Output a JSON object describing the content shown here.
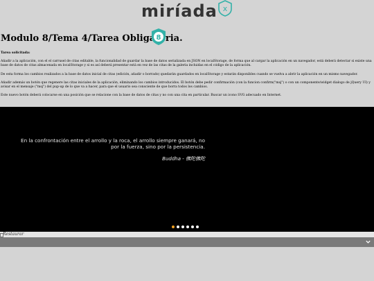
{
  "header": {
    "logo_text": "miríada",
    "logo_badge": "x"
  },
  "page": {
    "title": "Modulo 8/Tema 4/Tarea Obligatoria.",
    "title_badge": "8"
  },
  "task": {
    "label": "Tarea solicitada:",
    "paragraphs": [
      "Añadir a la aplicación, con el el carrusel de citas editable, la funcionalidad de guardar la base de datos serializada en JSON en localStorage, de forma que al cargar la aplicación en un navegador, está deberá detectar si existe una base de datos de citas almacenada en localStorage y si es así deberá presentar está en vez de las citas de la galeria incluidas en el código de la aplicación.",
      "De esta forma los cambios realizados a la base de datos inicial de citas (edición, añadir o borrado) quedarán guardados en localStorage y estarán disponibles cuando se vuelva a abrir la aplicación en un mismo navegador.",
      "Añadir además un botón que regenere las citas iniciales de la aplicación, eliminando los cambios introducidos. El botón debe pedir confirmación (con la funcion confirm(\"msj\") o con un componente/widget dialogo de jQuery UI) y avisar en el mensaje (\"msj\") del pup-up de lo que va a hacer, para que el usuario sea consciente de que borra todos los cambios.",
      "Este nuevo botón deberá colocarse en una posición que se relacione con la base de datos de citas y no con una cita en particular. Buscar un icono SVG adecuado en Internet."
    ]
  },
  "carousel": {
    "quote": "En la confrontación entre el arrollo y la roca, el arrollo siempre ganará, no por la fuerza, sino por la persistencia.",
    "author": "Buddha - 佛陀佛陀",
    "slide_count": 6,
    "active_index": 0
  },
  "restore": {
    "alt_text": "Restaurar"
  },
  "colors": {
    "background": "#d4d4d4",
    "carousel": "#000000",
    "active_dot": "#f0a020",
    "badge": "#33b1a8",
    "gallery_bar": "#7a7a7a"
  },
  "icons": {
    "logo_badge": "x-shield-icon",
    "title_badge": "8-shield-icon",
    "chevron": "chevron-down-icon"
  }
}
